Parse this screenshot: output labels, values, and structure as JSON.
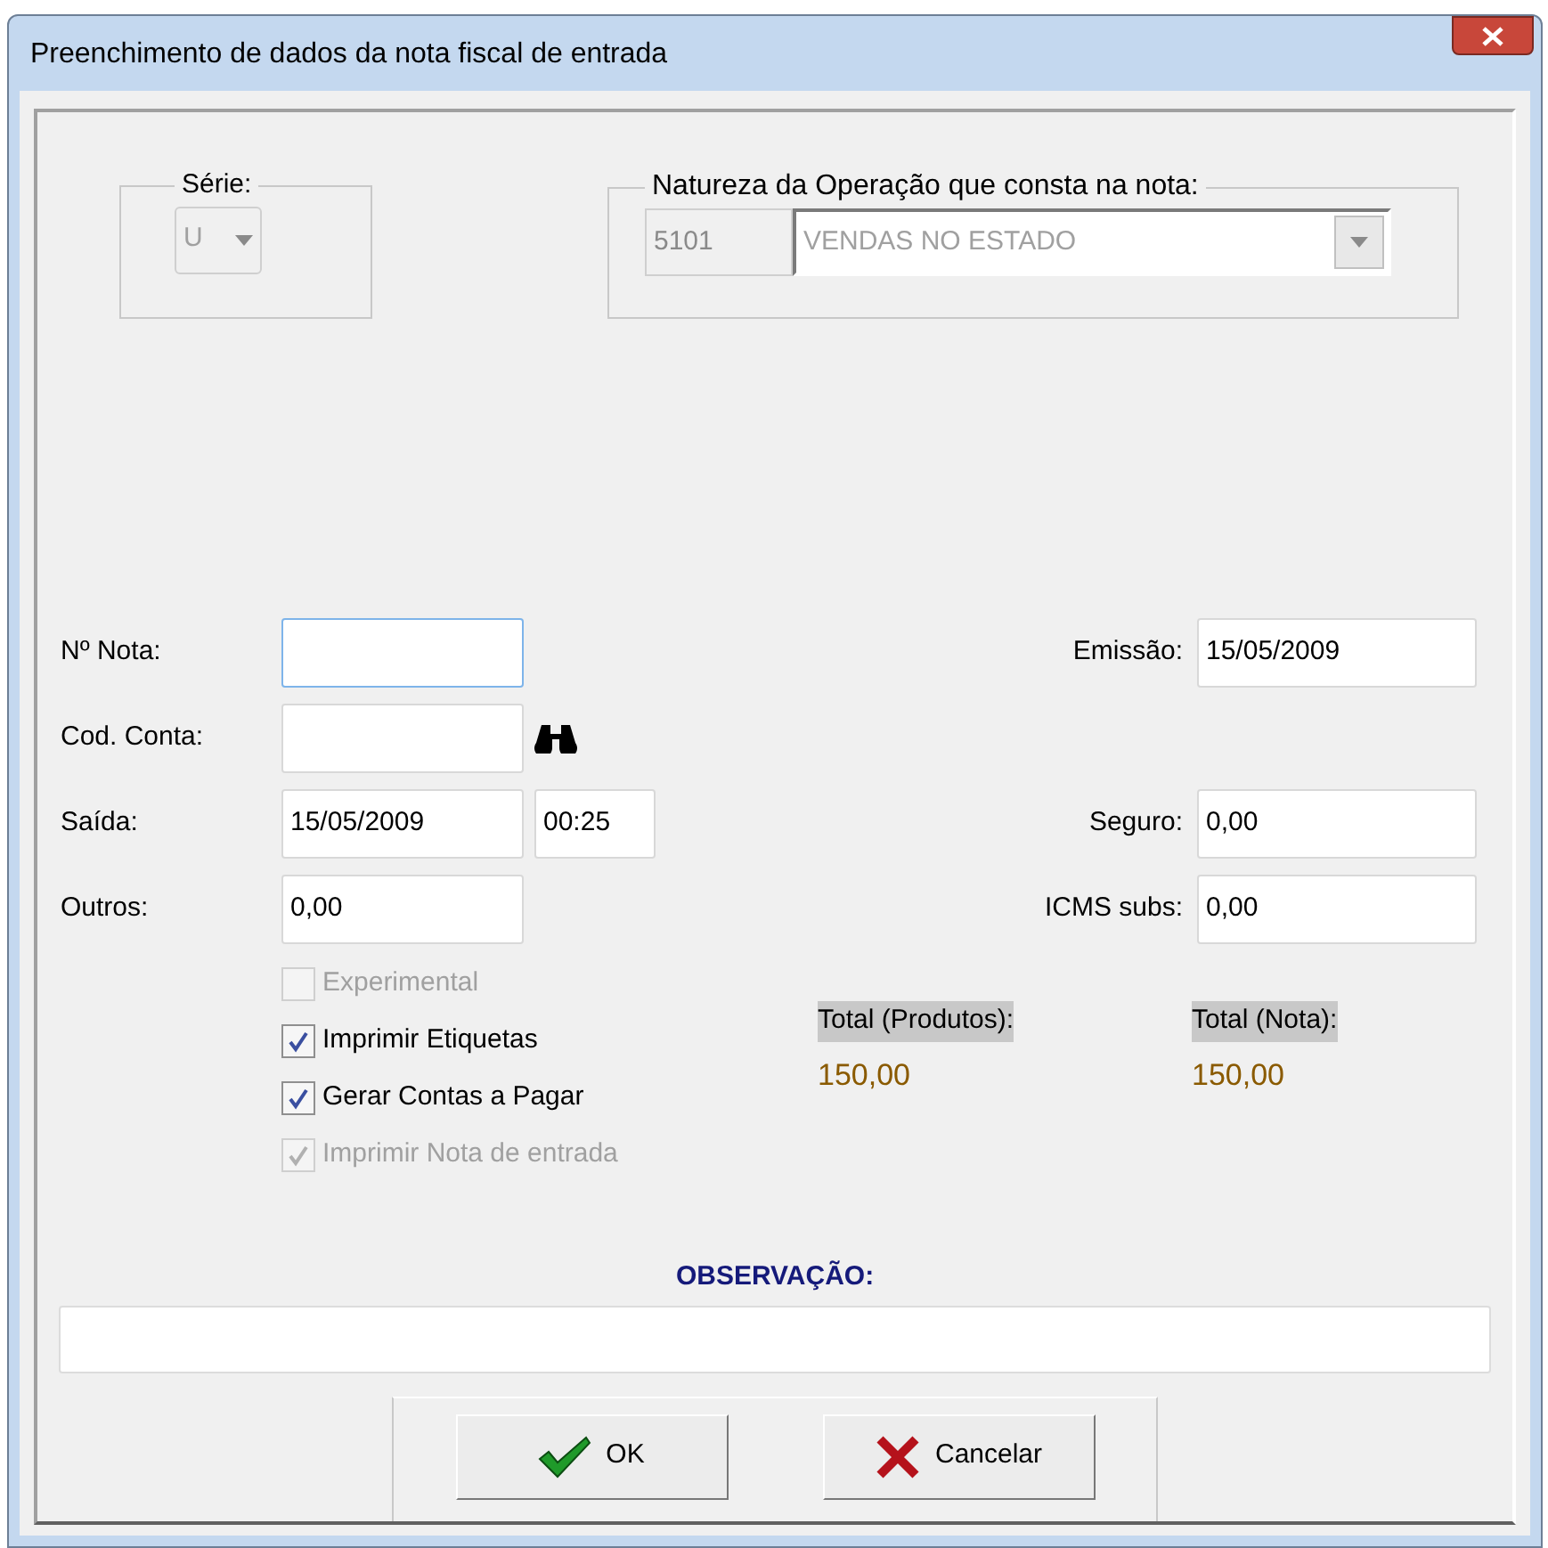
{
  "window": {
    "title": "Preenchimento de dados da nota fiscal de entrada"
  },
  "serie": {
    "label": "Série:",
    "value": "U",
    "disabled": true
  },
  "natureza": {
    "label": "Natureza da Operação que consta na nota:",
    "code": "5101",
    "value": "VENDAS NO ESTADO",
    "disabled": true
  },
  "rows": [
    {
      "left": {
        "label": "Nº Nota:",
        "focused": true
      },
      "right": {
        "label": "Emissão:",
        "value": "15/05/2009"
      }
    },
    {
      "left": {
        "label": "Cod. Conta:",
        "focused": false,
        "kind": "lookup"
      }
    },
    {
      "left": {
        "label": "Saída:",
        "value": "15/05/2009",
        "time": "00:25",
        "focused": false
      },
      "right": {
        "label": "Seguro:",
        "value": "0,00"
      }
    },
    {
      "left": {
        "label": "Outros:",
        "value": "0,00",
        "focused": false
      },
      "right": {
        "label": "ICMS subs:",
        "value": "0,00"
      }
    }
  ],
  "checkboxes": [
    {
      "label": "Experimental",
      "checked": false,
      "disabled": true
    },
    {
      "label": "Imprimir Etiquetas",
      "checked": true,
      "disabled": false
    },
    {
      "label": "Gerar Contas a Pagar",
      "checked": true,
      "disabled": false
    },
    {
      "label": "Imprimir Nota de entrada",
      "checked": true,
      "disabled": true
    }
  ],
  "totals": [
    {
      "label": "Total (Produtos):",
      "value": "150,00"
    },
    {
      "label": "Total (Nota):",
      "value": "150,00"
    }
  ],
  "observacao": {
    "label": "OBSERVAÇÃO:"
  },
  "buttons": [
    {
      "label": "OK",
      "kind": "ok"
    },
    {
      "label": "Cancelar",
      "kind": "cancel"
    }
  ]
}
